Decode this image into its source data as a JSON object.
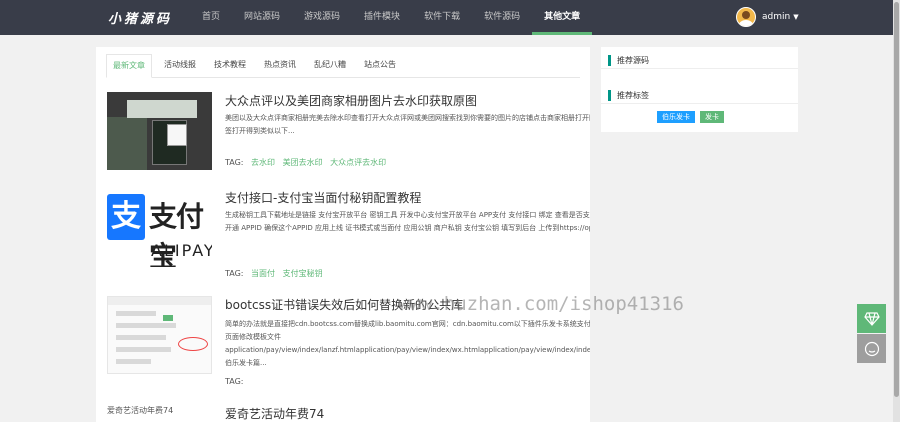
{
  "brand": {
    "logo_text": "小猪源码"
  },
  "nav": {
    "items": [
      {
        "label": "首页"
      },
      {
        "label": "网站源码"
      },
      {
        "label": "游戏源码"
      },
      {
        "label": "插件模块"
      },
      {
        "label": "软件下载"
      },
      {
        "label": "软件源码"
      },
      {
        "label": "其他文章"
      }
    ],
    "active": "其他文章"
  },
  "user": {
    "name": "admin"
  },
  "tabs": [
    {
      "label": "最新文章"
    },
    {
      "label": "活动线报"
    },
    {
      "label": "技术教程"
    },
    {
      "label": "热点资讯"
    },
    {
      "label": "乱纪八糟"
    },
    {
      "label": "站点公告"
    }
  ],
  "articles": [
    {
      "title": "大众点评以及美团商家相册图片去水印获取原图",
      "desc": "美团以及大众点评商家相册完美去除水印查看打开大众点评网或美团网搜索找到你需要的图片的店铺点击商家相册打开图片右键新标签打开得到类似以下...",
      "tag_label": "TAG:",
      "tags": [
        "去水印",
        "美团去水印",
        "大众点评去水印"
      ]
    },
    {
      "title": "支付接口-支付宝当面付秘钥配置教程",
      "desc": "生成秘钥工具下载地址是链接 支付宝开放平台 密钥工具 开发中心支付宝开放平台 APP支付 支付接口 绑定 查看是否支付宝当面付已开通 APPID 确保这个APPID 应用上线 证书模式或当面付 应用公钥 商户私钥 支付宝公钥 填写到后台 上传到https://openhome....",
      "tag_label": "TAG:",
      "tags": [
        "当面付",
        "支付宝秘钥"
      ]
    },
    {
      "title": "bootcss证书错误失效后如何替换新的公共库",
      "desc": "简单的办法就是直接把cdn.bootcss.com替换成lib.baomitu.com官网：cdn.baomitu.com以下插件乐发卡系统支付页面修改模板文件application/pay/view/index/lanzf.htmlapplication/pay/view/index/wx.htmlapplication/pay/view/index/index.html 伯乐发卡篇...",
      "tag_label": "TAG:",
      "tags": []
    },
    {
      "title": "爱奇艺活动年费74",
      "thumb_alt": "爱奇艺活动年费74"
    }
  ],
  "side": {
    "recommend_title": "推荐源码",
    "tags_title": "推荐标签",
    "tags": [
      {
        "label": "伯乐发卡",
        "color": "#1e9fff"
      },
      {
        "label": "发卡",
        "color": "#5fb878"
      }
    ]
  },
  "watermark": "www.huzhan.com/ishop41316",
  "thumb_texts": {
    "alipay_word": "支付宝",
    "alipay_latin": "ALIPAY",
    "alipay_mark": "支"
  }
}
